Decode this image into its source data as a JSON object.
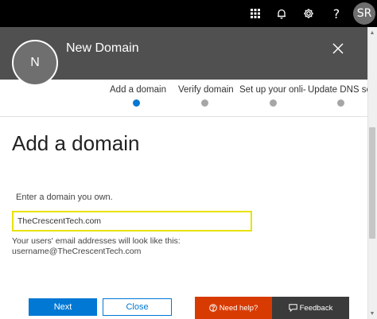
{
  "topbar": {
    "icons": [
      "app-launcher-icon",
      "bell-icon",
      "gear-icon",
      "help-icon"
    ],
    "help_glyph": "?",
    "user_initials": "SR"
  },
  "panel": {
    "avatar_letter": "N",
    "title": "New Domain",
    "close_icon": "close-icon"
  },
  "steps": [
    {
      "label": "Add a domain",
      "active": true
    },
    {
      "label": "Verify domain",
      "active": false
    },
    {
      "label": "Set up your onli‐",
      "active": false
    },
    {
      "label": "Update DNS se",
      "active": false
    }
  ],
  "content": {
    "title": "Add a domain",
    "prompt": "Enter a domain you own.",
    "domain_value": "TheCrescentTech.com",
    "help_line_1": "Your users' email addresses will look like this:",
    "help_line_2": "username@TheCrescentTech.com"
  },
  "buttons": {
    "next": "Next",
    "close": "Close"
  },
  "support": {
    "need_help": "Need help?",
    "feedback": "Feedback"
  },
  "colors": {
    "accent": "#0078d4",
    "header_bg": "#505050",
    "need_help_bg": "#d83b01",
    "feedback_bg": "#3b3b3b",
    "input_highlight": "#e8e200"
  }
}
